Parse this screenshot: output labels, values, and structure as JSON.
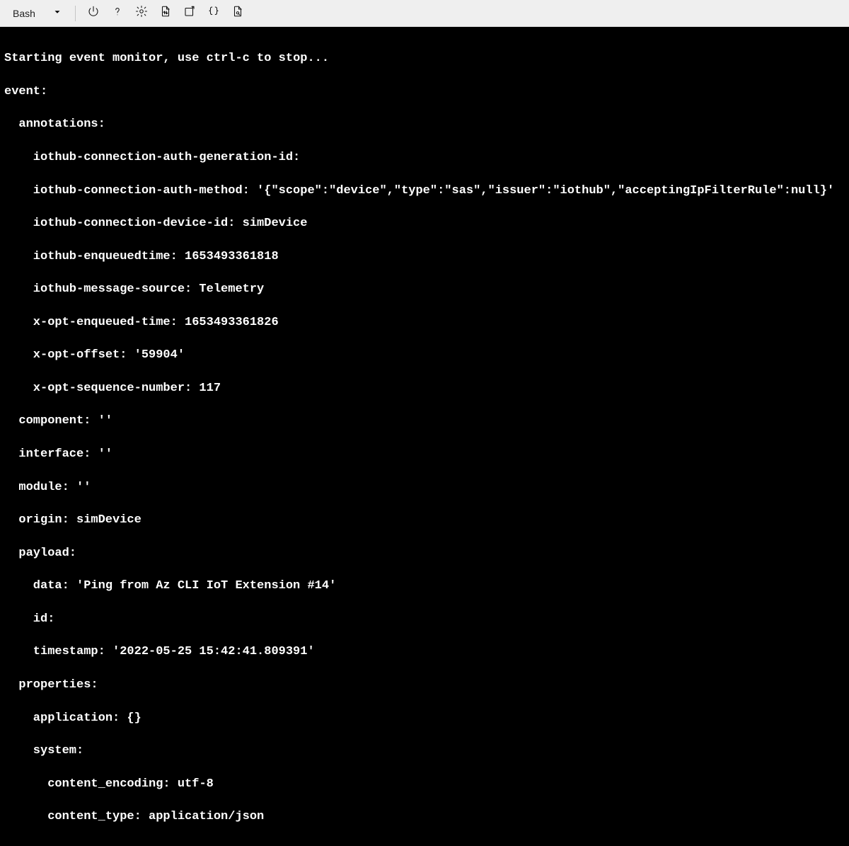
{
  "toolbar": {
    "shell_label": "Bash"
  },
  "term": {
    "start_line": "Starting event monitor, use ctrl-c to stop...",
    "event_label": "event:",
    "annotations_label": "annotations:",
    "anno": {
      "auth_gen": "iothub-connection-auth-generation-id:",
      "auth_method": "iothub-connection-auth-method: '{\"scope\":\"device\",\"type\":\"sas\",\"issuer\":\"iothub\",\"acceptingIpFilterRule\":null}'",
      "device_id": "iothub-connection-device-id: simDevice",
      "enqueued": "iothub-enqueuedtime: 1653493361818",
      "msg_source": "iothub-message-source: Telemetry",
      "opt_enq": "x-opt-enqueued-time: 1653493361826",
      "opt_offset": "x-opt-offset: '59904'",
      "opt_seq": "x-opt-sequence-number: 117"
    },
    "component": "component: ''",
    "interface": "interface: ''",
    "module": "module: ''",
    "origin": "origin: simDevice",
    "payload_label": "payload:",
    "payload": {
      "data": "data: 'Ping from Az CLI IoT Extension #14'",
      "id": "id:",
      "timestamp": "timestamp: '2022-05-25 15:42:41.809391'"
    },
    "properties_label": "properties:",
    "properties": {
      "application": "application: {}",
      "system_label": "system:",
      "content_encoding": "content_encoding: utf-8",
      "content_type": "content_type: application/json"
    }
  }
}
